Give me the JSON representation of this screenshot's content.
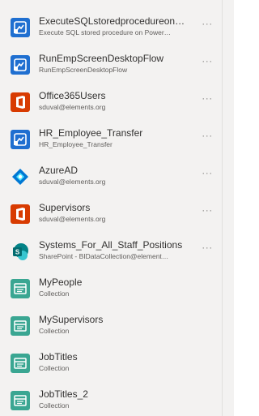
{
  "data_sources": [
    {
      "title": "ExecuteSQLstoredprocedureon…",
      "subtitle": "Execute SQL stored procedure on Power…",
      "icon": "flow-icon",
      "has_more": true,
      "more_label": "···"
    },
    {
      "title": "RunEmpScreenDesktopFlow",
      "subtitle": "RunEmpScreenDesktopFlow",
      "icon": "flow-icon",
      "has_more": true,
      "more_label": "···"
    },
    {
      "title": "Office365Users",
      "subtitle": "sduval@elements.org",
      "icon": "office-icon",
      "has_more": true,
      "more_label": "···"
    },
    {
      "title": "HR_Employee_Transfer",
      "subtitle": "HR_Employee_Transfer",
      "icon": "flow-icon",
      "has_more": true,
      "more_label": "···"
    },
    {
      "title": "AzureAD",
      "subtitle": "sduval@elements.org",
      "icon": "azure-ad-icon",
      "has_more": true,
      "more_label": "···"
    },
    {
      "title": "Supervisors",
      "subtitle": "sduval@elements.org",
      "icon": "office-icon",
      "has_more": true,
      "more_label": "···"
    },
    {
      "title": "Systems_For_All_Staff_Positions",
      "subtitle": "SharePoint - BIDataCollection@element…",
      "icon": "sharepoint-icon",
      "has_more": true,
      "more_label": "···"
    },
    {
      "title": "MyPeople",
      "subtitle": "Collection",
      "icon": "collection-icon",
      "has_more": false,
      "more_label": ""
    },
    {
      "title": "MySupervisors",
      "subtitle": "Collection",
      "icon": "collection-icon",
      "has_more": false,
      "more_label": ""
    },
    {
      "title": "JobTitles",
      "subtitle": "Collection",
      "icon": "collection-icon",
      "has_more": false,
      "more_label": ""
    },
    {
      "title": "JobTitles_2",
      "subtitle": "Collection",
      "icon": "collection-icon",
      "has_more": false,
      "more_label": ""
    }
  ],
  "colors": {
    "flow": "#0f6cbd",
    "office": "#d83b01",
    "azure": "#0078d4",
    "sharepoint": "#036c70",
    "collection": "#3aa692"
  }
}
